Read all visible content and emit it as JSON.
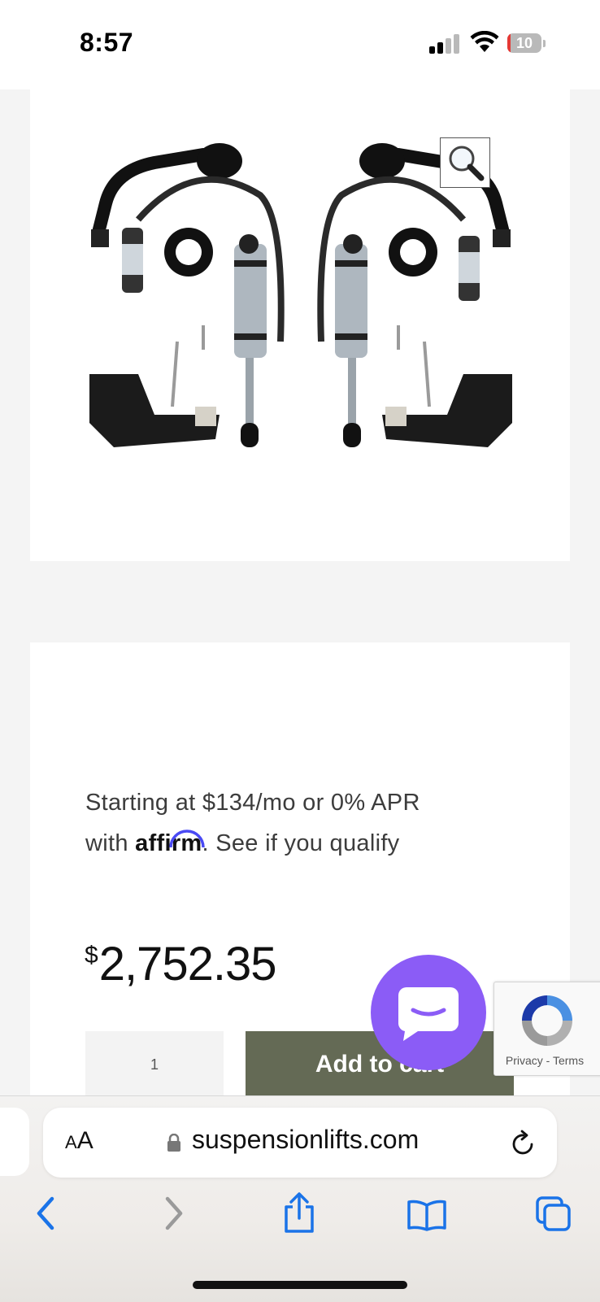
{
  "status_bar": {
    "time": "8:57",
    "battery_level": "10"
  },
  "product": {
    "image_alt": "Suspension shock kit",
    "affirm_prefix": "Starting at $134/mo or 0% APR",
    "affirm_with": "with",
    "affirm_brand": "affirm",
    "affirm_suffix": ". See if you qualify",
    "price_currency": "$",
    "price_value": "2,752.35",
    "quantity": "1",
    "add_to_cart_label": "Add to cart"
  },
  "recaptcha": {
    "privacy": "Privacy",
    "separator": " - ",
    "terms": "Terms"
  },
  "browser": {
    "aa_label_small": "A",
    "aa_label_large": "A",
    "url": "suspensionlifts.com"
  },
  "colors": {
    "add_to_cart_bg": "#646a55",
    "chat_button": "#8b5cf6",
    "safari_accent": "#1a73e8",
    "battery_low": "#e53935"
  },
  "icons": {
    "zoom": "magnifier-icon",
    "chat": "chat-bubble-icon",
    "lock": "lock-icon",
    "reload": "reload-icon",
    "back": "chevron-left-icon",
    "forward": "chevron-right-icon",
    "share": "share-icon",
    "bookmarks": "book-icon",
    "tabs": "tabs-icon"
  }
}
